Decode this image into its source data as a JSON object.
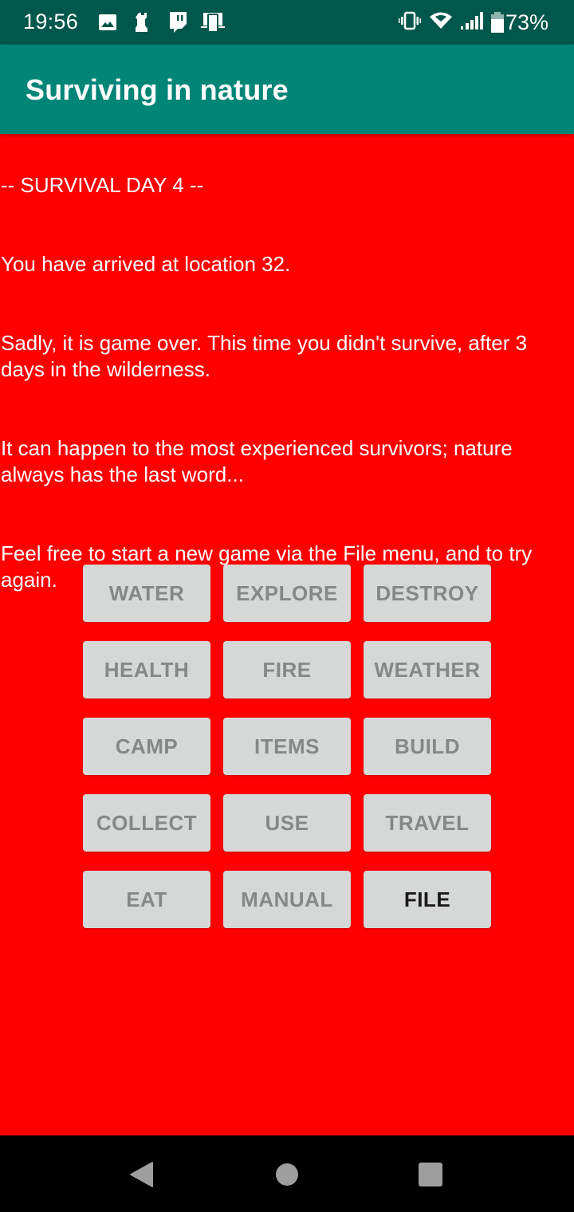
{
  "status_bar": {
    "time": "19:56",
    "notification_icons": [
      "image-icon",
      "chess-rook-icon",
      "twitch-icon",
      "device-sync-icon"
    ],
    "system_icons": [
      "vibrate-icon",
      "wifi-icon",
      "signal-icon",
      "battery-icon"
    ],
    "battery_percent": "73%"
  },
  "app_bar": {
    "title": "Surviving in nature"
  },
  "log": {
    "lines": [
      "-- SURVIVAL DAY 4 --",
      "You have arrived at location 32.",
      "Sadly, it is game over. This time you didn't survive, after 3 days in the wilderness.",
      "It can happen to the most experienced survivors; nature always has the last word...",
      "Feel free to start a new game via the File menu, and to try again."
    ]
  },
  "actions": {
    "buttons": [
      {
        "label": "WATER",
        "enabled": false
      },
      {
        "label": "EXPLORE",
        "enabled": false
      },
      {
        "label": "DESTROY",
        "enabled": false
      },
      {
        "label": "HEALTH",
        "enabled": false
      },
      {
        "label": "FIRE",
        "enabled": false
      },
      {
        "label": "WEATHER",
        "enabled": false
      },
      {
        "label": "CAMP",
        "enabled": false
      },
      {
        "label": "ITEMS",
        "enabled": false
      },
      {
        "label": "BUILD",
        "enabled": false
      },
      {
        "label": "COLLECT",
        "enabled": false
      },
      {
        "label": "USE",
        "enabled": false
      },
      {
        "label": "TRAVEL",
        "enabled": false
      },
      {
        "label": "EAT",
        "enabled": false
      },
      {
        "label": "MANUAL",
        "enabled": false
      },
      {
        "label": "FILE",
        "enabled": true
      }
    ]
  },
  "nav_bar": {
    "buttons": [
      "back",
      "home",
      "recents"
    ]
  },
  "colors": {
    "status_bar": "#00574b",
    "app_bar": "#008577",
    "background": "#ff0000",
    "button_bg": "#d6d7d7",
    "button_text_disabled": "#868787",
    "button_text_enabled": "#1a1a1a"
  }
}
